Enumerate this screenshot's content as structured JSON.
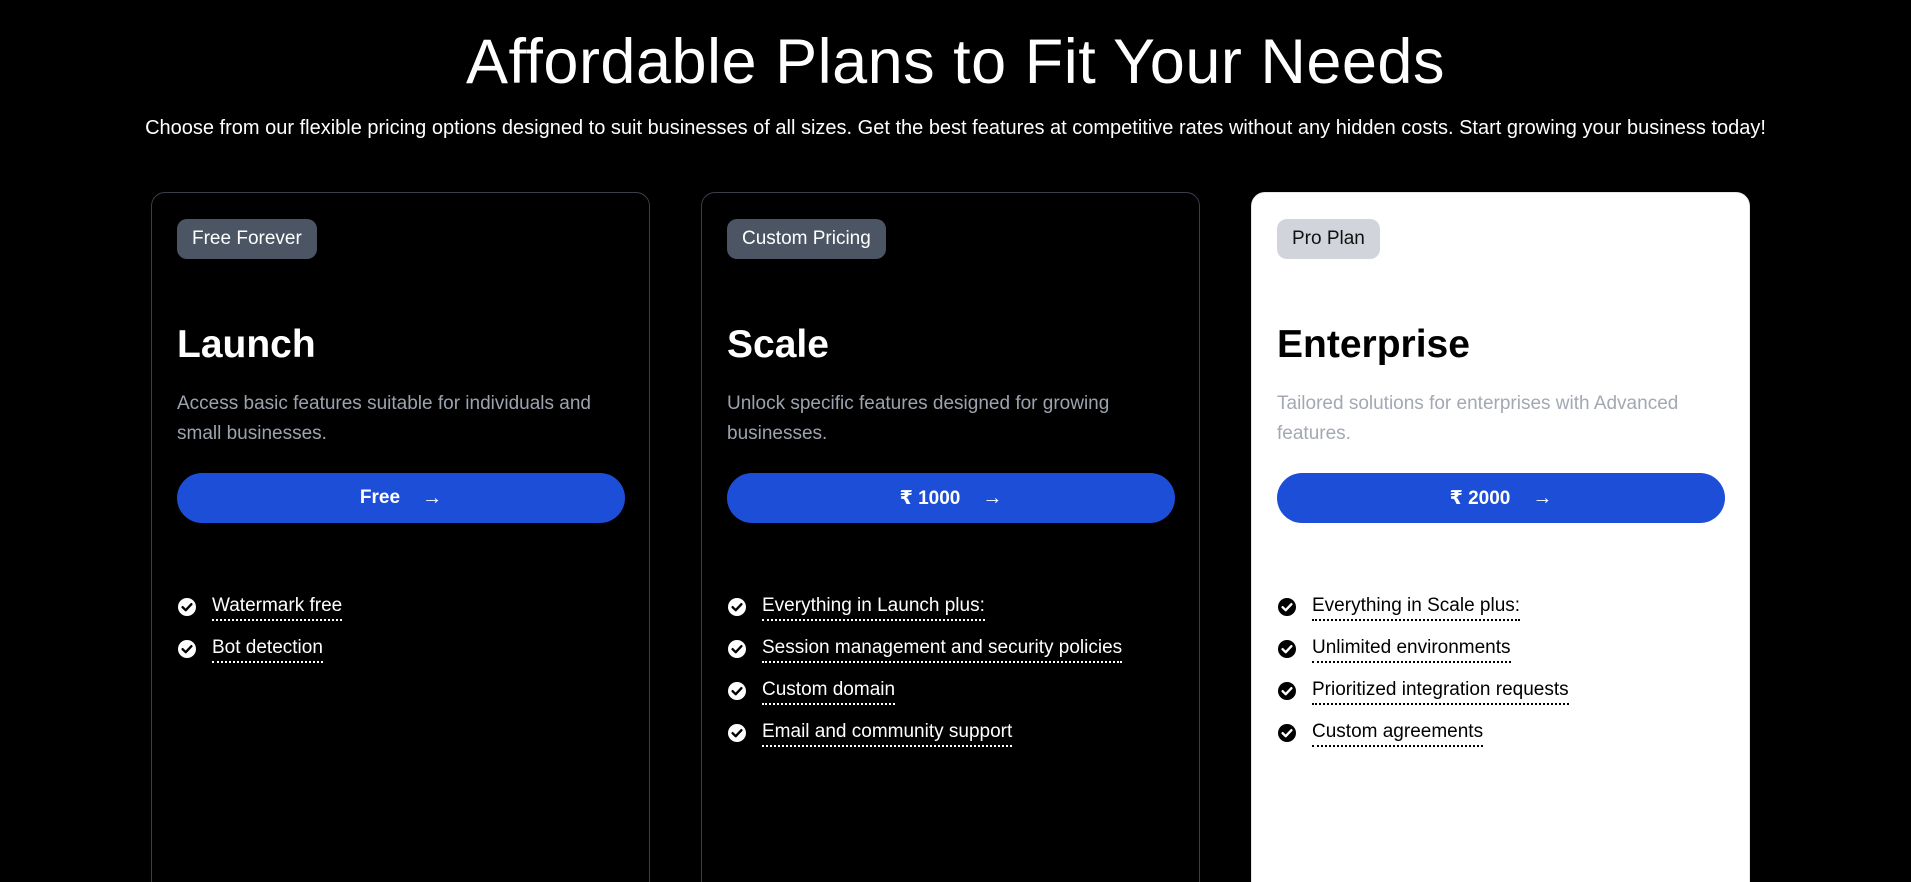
{
  "hero": {
    "title": "Affordable Plans to Fit Your Needs",
    "subtitle": "Choose from our flexible pricing options designed to suit businesses of all sizes. Get the best features at competitive rates without any hidden costs. Start growing your business today!"
  },
  "colors": {
    "background": "#000000",
    "accent_button": "#1d4ed8",
    "dark_badge": "#4b5563",
    "light_badge": "#d1d5db",
    "muted_text": "#9ca3af"
  },
  "plans": [
    {
      "badge": "Free Forever",
      "name": "Launch",
      "description": "Access basic features suitable for individuals and small businesses.",
      "price_label": "Free",
      "button_icon": "arrow-right-icon",
      "features": [
        "Watermark free",
        "Bot detection"
      ]
    },
    {
      "badge": "Custom Pricing",
      "name": "Scale",
      "description": "Unlock specific features designed for growing businesses.",
      "price_label": "₹ 1000",
      "button_icon": "arrow-right-icon",
      "features": [
        "Everything in Launch plus:",
        "Session management and security policies",
        "Custom domain",
        "Email and community support"
      ]
    },
    {
      "badge": "Pro Plan",
      "name": "Enterprise",
      "description": "Tailored solutions for enterprises with Advanced features.",
      "price_label": "₹ 2000",
      "button_icon": "arrow-right-icon",
      "features": [
        "Everything in Scale plus:",
        "Unlimited environments",
        "Prioritized integration requests",
        "Custom agreements"
      ]
    }
  ]
}
